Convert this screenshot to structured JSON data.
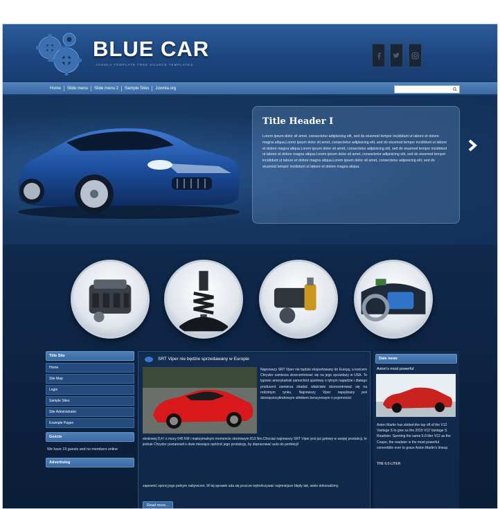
{
  "brand": {
    "title": "BLUE CAR",
    "subtitle": "JOOMLA TEMPLATE FREE SOURCE TEMPLATES"
  },
  "social": [
    "facebook-icon",
    "twitter-icon",
    "instagram-icon"
  ],
  "nav": {
    "items": [
      "Home",
      "Slide menu",
      "Slide menu 2",
      "Sample Sites",
      "Joomla.org"
    ],
    "search_placeholder": ""
  },
  "hero": {
    "title": "Title Header I",
    "text": "Lorem ipsum dolor sit amet, consectetur adipisicing elit, sed do eiusmod tempor incididunt ut labore et dolore magna aliqua.Lorem ipsum dolor sit amet, consectetur adipisicing elit, sed do eiusmod tempor incididunt ut labore et dolore magna aliqua.Lorem ipsum dolor sit amet, consectetur adipisicing elit, sed do eiusmod tempor incididunt ut labore et dolore magna aliqua.Lorem ipsum dolor sit amet, consectetur adipisicing elit, sed do eiusmod tempor incididunt ut labore et dolore magna aliqua.Lorem ipsum dolor sit amet, consectetur adipisicing elit, sed do eiusmod tempor incididunt ut labore et dolore magna aliqua."
  },
  "left": {
    "menu_title": "Title Site",
    "menu_items": [
      "Home",
      "Site Map",
      "Login",
      "Sample Sites",
      "Site Administrator",
      "Example Pages"
    ],
    "guests_title": "Goście",
    "guests_text": "We have 19 guests and no members online",
    "ad_title": "Advertising"
  },
  "article": {
    "title": "SRT Viper nie będzie sprzedawany w Europie",
    "side_text": "Najnowszy SRT Viper nie będzie eksportowany do Europy, a koncern Chrysler zamierza skoncentrować się na jego sprzedaży w USA. To typowo amerykański samochód sportowy o tylnym napędzie i dlatego producent zamierza zbadać właściwie skoncentrować się na rodzimym rynku. Najnowszy Viper napędzany jest dziesięciocylindrowym silnikiem benzynowym o pojemności",
    "body": "skokowej 8,4 l o mocy 645 KM i maksymalnym momencie obrotowym 813 Nm.Chociaż najnowszy SRT Viper jest już gotowy w swojej produkcji, to jednak Chrysler postanowił o dwie miesiące opóźnić jego produkcję, by dopracować auto do perfekcji!",
    "more": "zapewnić sporej jego pełnym nabywcom. W tej sprawie uda się jeszcze wykończywać najmniejsze błędy tak, wiele dokonaliśmy.",
    "read_more": "Read more..."
  },
  "right": {
    "title": "Dale news",
    "subtitle": "Aston's most powerful",
    "text": "Aston Martin has slotted the top off of the V12 Vantage S to give us the 2015 V12 Vantage S Roadster. Sporting the same 6.0-liter V12 as the Coupe, the roadster is the most powerful convertible ever to grace Aston Martin's lineup.",
    "footer": "THE 6.0-LITER"
  },
  "colors": {
    "background": "#0d2342",
    "nav": "#3a6aa4",
    "accent": "#4f7fb8"
  }
}
